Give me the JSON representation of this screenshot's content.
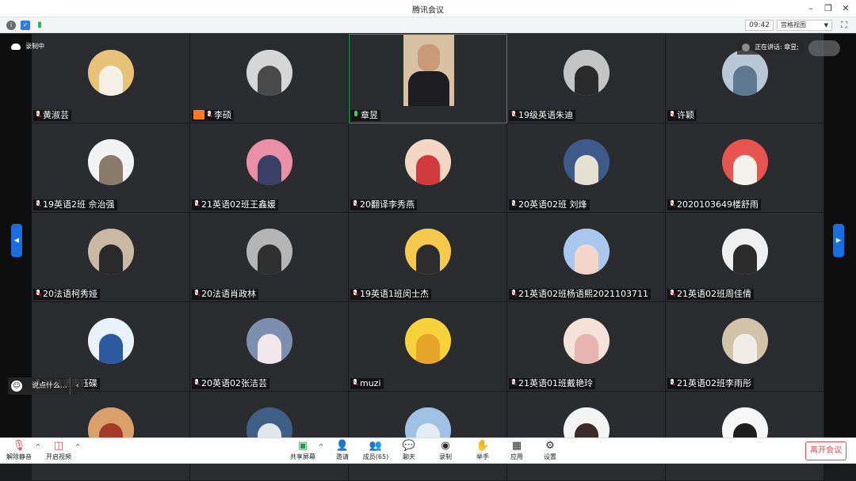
{
  "window": {
    "title": "腾讯会议"
  },
  "toolbar": {
    "time": "09:42",
    "view_label": "宫格视图"
  },
  "recording": {
    "label": "录制中"
  },
  "speaking": {
    "label": "正在讲话: 章昱;"
  },
  "chat": {
    "placeholder": "说点什么..."
  },
  "colors": {
    "accent": "#1a6fe0",
    "active_border": "#1f9c4e",
    "leave": "#e5484d",
    "host_badge": "#ff7a1a"
  },
  "participants": [
    {
      "name": "黄淑芸",
      "muted": true,
      "av": [
        "#e9c27a",
        "#f5f0e6"
      ]
    },
    {
      "name": "李硕",
      "muted": true,
      "host": true,
      "av": [
        "#d6d6d6",
        "#4a4a4a"
      ]
    },
    {
      "name": "章昱",
      "muted": false,
      "active": true,
      "photo": true
    },
    {
      "name": "19级英语朱迪",
      "muted": true,
      "av": [
        "#c4c4c4",
        "#2b2b2b"
      ]
    },
    {
      "name": "许颖",
      "muted": true,
      "av": [
        "#b9c8d6",
        "#5f7a90"
      ]
    },
    {
      "name": "19英语2班 佘治强",
      "muted": true,
      "av": [
        "#f2f2f2",
        "#8a7a6a"
      ]
    },
    {
      "name": "21英语02班王鑫媛",
      "muted": true,
      "av": [
        "#ea8fa5",
        "#3a3f66"
      ]
    },
    {
      "name": "20翻译李秀燕",
      "muted": true,
      "av": [
        "#f3d7c4",
        "#d23b3b"
      ]
    },
    {
      "name": "20英语02班 刘烽",
      "muted": true,
      "av": [
        "#3d5a8a",
        "#e6e0d0"
      ]
    },
    {
      "name": "2020103649楼舒雨",
      "muted": true,
      "av": [
        "#e8554e",
        "#f4f1ec"
      ]
    },
    {
      "name": "20法语柯秀娅",
      "muted": true,
      "av": [
        "#c9b8a4",
        "#2a2a2a"
      ]
    },
    {
      "name": "20法语肖政林",
      "muted": true,
      "av": [
        "#b5b5b5",
        "#2f2f2f"
      ]
    },
    {
      "name": "19英语1班闵士杰",
      "muted": true,
      "av": [
        "#f6c94d",
        "#2d2d2d"
      ]
    },
    {
      "name": "21英语02班杨语熙2021103711",
      "muted": true,
      "av": [
        "#a9c7ec",
        "#f4d6c9"
      ]
    },
    {
      "name": "21英语02班周佳倩",
      "muted": true,
      "av": [
        "#f0f0f0",
        "#2c2c2c"
      ]
    },
    {
      "name": "21法语周钰碟",
      "muted": true,
      "av": [
        "#e9f1fb",
        "#2c5aa0"
      ]
    },
    {
      "name": "20英语02张洁芸",
      "muted": true,
      "av": [
        "#7c8fae",
        "#f1e6ea"
      ]
    },
    {
      "name": "muzi",
      "muted": true,
      "av": [
        "#f7d23b",
        "#e8a428"
      ]
    },
    {
      "name": "21英语01班戴艳玲",
      "muted": true,
      "av": [
        "#f4e2d8",
        "#e8b4b0"
      ]
    },
    {
      "name": "21英语02班李雨彤",
      "muted": true,
      "av": [
        "#d2c2a8",
        "#f0ece6"
      ]
    },
    {
      "name": "",
      "muted": true,
      "av": [
        "#d9a06b",
        "#a33a2a"
      ]
    },
    {
      "name": "",
      "muted": true,
      "av": [
        "#3f5f86",
        "#dfe6ee"
      ]
    },
    {
      "name": "",
      "muted": true,
      "av": [
        "#9fc2e4",
        "#e2ecf4"
      ]
    },
    {
      "name": "",
      "muted": true,
      "av": [
        "#f3f3f3",
        "#3a2a2a"
      ]
    },
    {
      "name": "",
      "muted": true,
      "av": [
        "#f6f6f6",
        "#1f1f1f"
      ]
    }
  ],
  "bottombar": {
    "unmute": "解除静音",
    "start_video": "开启视频",
    "share_screen": "共享屏幕",
    "invite": "邀请",
    "members": "成员(65)",
    "chat": "聊天",
    "record": "录制",
    "raise_hand": "举手",
    "apps": "应用",
    "settings": "设置",
    "leave": "离开会议"
  }
}
